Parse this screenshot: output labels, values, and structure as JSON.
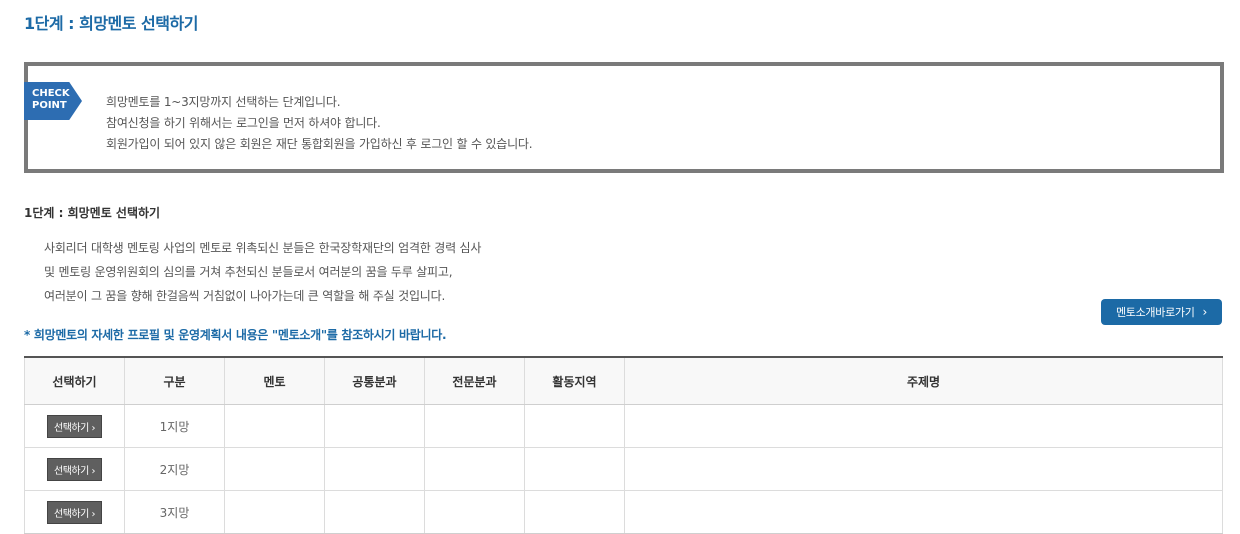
{
  "page": {
    "title": "1단계 : 희망멘토 선택하기"
  },
  "checkpoint": {
    "badge_line1": "CHECK",
    "badge_line2": "POINT",
    "lines": [
      "희망멘토를 1~3지망까지 선택하는 단계입니다.",
      "참여신청을 하기 위해서는 로그인을 먼저 하셔야 합니다.",
      "회원가입이 되어 있지 않은 회원은 재단 통합회원을 가입하신 후 로그인 할 수 있습니다."
    ]
  },
  "section": {
    "title": "1단계 : 희망멘토 선택하기",
    "intro": [
      "사회리더 대학생 멘토링 사업의 멘토로 위촉되신 분들은 한국장학재단의 엄격한 경력 심사",
      "및 멘토링 운영위원회의 심의를 거쳐 추천되신 분들로서 여러분의 꿈을 두루 살피고,",
      "여러분이 그 꿈을 향해 한걸음씩 거침없이 나아가는데 큰 역할을 해 주실 것입니다."
    ],
    "mentor_intro_button": "멘토소개바로가기",
    "notice": "* 희망멘토의 자세한 프로필 및 운영계획서 내용은 \"멘토소개\"를 참조하시기 바랍니다."
  },
  "table": {
    "headers": [
      "선택하기",
      "구분",
      "멘토",
      "공통분과",
      "전문분과",
      "활동지역",
      "주제명"
    ],
    "rows": [
      {
        "select": "선택하기 ›",
        "rank": "1지망",
        "mentor": "",
        "common": "",
        "specialty": "",
        "region": "",
        "topic": ""
      },
      {
        "select": "선택하기 ›",
        "rank": "2지망",
        "mentor": "",
        "common": "",
        "specialty": "",
        "region": "",
        "topic": ""
      },
      {
        "select": "선택하기 ›",
        "rank": "3지망",
        "mentor": "",
        "common": "",
        "specialty": "",
        "region": "",
        "topic": ""
      }
    ]
  },
  "colors": {
    "accent": "#1c6aa6",
    "badge": "#2d6db2",
    "box_border": "#7a7a7a",
    "select_button": "#5f5f5f"
  },
  "icons": {
    "button_chevron": "chevron-right-icon"
  }
}
